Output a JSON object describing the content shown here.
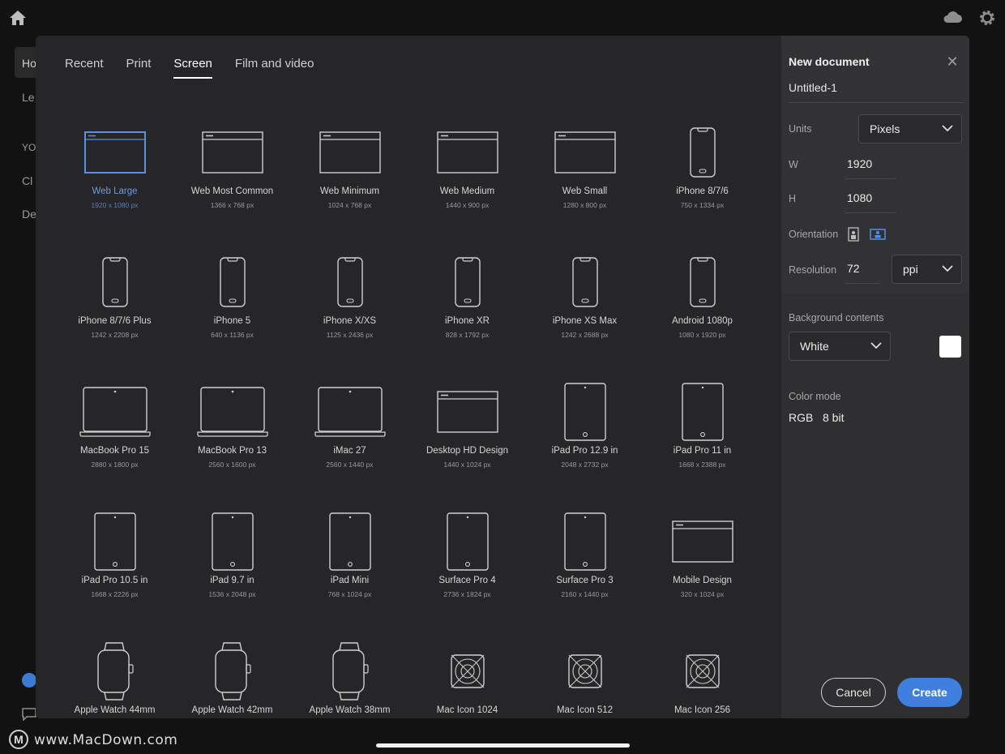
{
  "background": {
    "sidebar_partial": [
      "Ho",
      "Le",
      "YO",
      "Cl",
      "De"
    ]
  },
  "watermark": {
    "logo_letter": "M",
    "text": "www.MacDown.com"
  },
  "tabs": [
    {
      "label": "Recent"
    },
    {
      "label": "Print"
    },
    {
      "label": "Screen",
      "active": true
    },
    {
      "label": "Film and video"
    }
  ],
  "presets": [
    {
      "name": "Web Large",
      "size": "1920 x 1080 px",
      "icon": "browser-window-icon",
      "selected": true
    },
    {
      "name": "Web Most Common",
      "size": "1366 x 768 px",
      "icon": "browser-window-icon"
    },
    {
      "name": "Web Minimum",
      "size": "1024 x 768 px",
      "icon": "browser-window-icon"
    },
    {
      "name": "Web Medium",
      "size": "1440 x 900 px",
      "icon": "browser-window-icon"
    },
    {
      "name": "Web Small",
      "size": "1280 x 800 px",
      "icon": "browser-window-icon"
    },
    {
      "name": "iPhone 8/7/6",
      "size": "750 x 1334 px",
      "icon": "phone-icon"
    },
    {
      "name": "iPhone 8/7/6 Plus",
      "size": "1242 x 2208 px",
      "icon": "phone-icon"
    },
    {
      "name": "iPhone 5",
      "size": "640 x 1136 px",
      "icon": "phone-icon"
    },
    {
      "name": "iPhone X/XS",
      "size": "1125 x 2436 px",
      "icon": "phone-icon"
    },
    {
      "name": "iPhone XR",
      "size": "828 x 1792 px",
      "icon": "phone-icon"
    },
    {
      "name": "iPhone XS Max",
      "size": "1242 x 2688 px",
      "icon": "phone-icon"
    },
    {
      "name": "Android 1080p",
      "size": "1080 x 1920 px",
      "icon": "phone-icon"
    },
    {
      "name": "MacBook Pro 15",
      "size": "2880 x 1800 px",
      "icon": "laptop-icon"
    },
    {
      "name": "MacBook Pro 13",
      "size": "2560 x 1600 px",
      "icon": "laptop-icon"
    },
    {
      "name": "iMac 27",
      "size": "2560 x 1440 px",
      "icon": "laptop-icon"
    },
    {
      "name": "Desktop HD Design",
      "size": "1440 x 1024 px",
      "icon": "browser-window-icon"
    },
    {
      "name": "iPad Pro 12.9 in",
      "size": "2048 x 2732 px",
      "icon": "tablet-icon"
    },
    {
      "name": "iPad Pro 11 in",
      "size": "1668 x 2388 px",
      "icon": "tablet-icon"
    },
    {
      "name": "iPad Pro 10.5 in",
      "size": "1668 x 2226 px",
      "icon": "tablet-icon"
    },
    {
      "name": "iPad 9.7 in",
      "size": "1536 x 2048 px",
      "icon": "tablet-icon"
    },
    {
      "name": "iPad Mini",
      "size": "768 x 1024 px",
      "icon": "tablet-icon"
    },
    {
      "name": "Surface Pro 4",
      "size": "2736 x 1824 px",
      "icon": "tablet-icon"
    },
    {
      "name": "Surface Pro 3",
      "size": "2160 x 1440 px",
      "icon": "tablet-icon"
    },
    {
      "name": "Mobile Design",
      "size": "320 x 1024 px",
      "icon": "browser-window-icon"
    },
    {
      "name": "Apple Watch 44mm",
      "size": "",
      "icon": "watch-icon"
    },
    {
      "name": "Apple Watch 42mm",
      "size": "",
      "icon": "watch-icon"
    },
    {
      "name": "Apple Watch 38mm",
      "size": "",
      "icon": "watch-icon"
    },
    {
      "name": "Mac Icon 1024",
      "size": "",
      "icon": "app-icon-grid-icon"
    },
    {
      "name": "Mac Icon 512",
      "size": "",
      "icon": "app-icon-grid-icon"
    },
    {
      "name": "Mac Icon 256",
      "size": "",
      "icon": "app-icon-grid-icon"
    }
  ],
  "panel": {
    "title": "New document",
    "document_name": "Untitled-1",
    "units_label": "Units",
    "units_value": "Pixels",
    "width_label": "W",
    "width_value": "1920",
    "height_label": "H",
    "height_value": "1080",
    "orientation_label": "Orientation",
    "orientation_selected": "landscape",
    "resolution_label": "Resolution",
    "resolution_value": "72",
    "resolution_unit": "ppi",
    "background_label": "Background contents",
    "background_value": "White",
    "background_color": "#ffffff",
    "color_mode_label": "Color mode",
    "color_mode_value": "RGB",
    "bit_depth_value": "8 bit",
    "cancel_label": "Cancel",
    "create_label": "Create"
  },
  "colors": {
    "accent": "#3f7fe0",
    "selected_text": "#6c9be6"
  }
}
